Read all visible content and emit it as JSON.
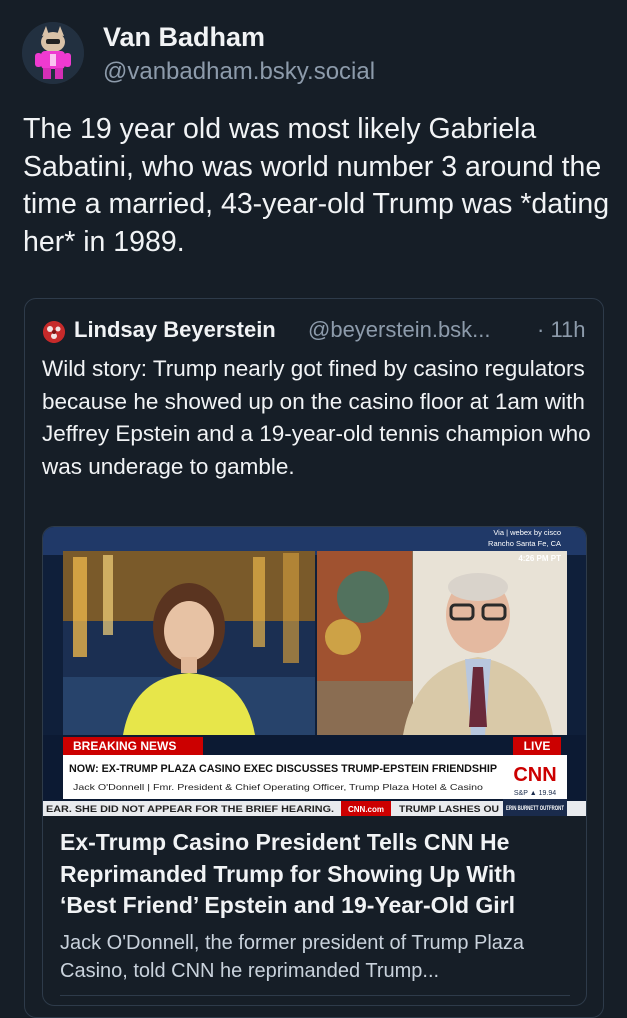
{
  "author": {
    "display_name": "Van Badham",
    "handle": "@vanbadham.bsky.social"
  },
  "post": {
    "text": "The 19 year old was most likely Gabriela Sabatini, who was world number 3 around the time a married, 43-year-old Trump was *dating her* in 1989."
  },
  "quote": {
    "display_name": "Lindsay Beyerstein",
    "handle": "@beyerstein.bsk...",
    "time": "· 11h",
    "text": "Wild story: Trump nearly got fined by casino regulators because he showed up on the casino floor at 1am with Jeffrey Epstein and a 19-year-old tennis champion who was underage to gamble."
  },
  "link_card": {
    "title": "Ex-Trump Casino President Tells CNN He Reprimanded Trump for Showing Up With ‘Best Friend’ Epstein and 19-Year-Old Girl",
    "description": "Jack O'Donnell, the former president of Trump Plaza Casino, told CNN he reprimanded Trump...",
    "thumbnail": {
      "via": "Via | webex by cisco",
      "location": "Rancho Santa Fe, CA",
      "clock": "4:26 PM PT",
      "breaking": "BREAKING NEWS",
      "live": "LIVE",
      "headline": "NOW: EX-TRUMP PLAZA CASINO EXEC DISCUSSES TRUMP-EPSTEIN FRIENDSHIP",
      "lower_third": "Jack O'Donnell  |  Fmr. President & Chief Operating Officer, Trump Plaza Hotel & Casino",
      "network": "CNN",
      "market": "S&P ▲ 19.94",
      "ticker": "EAR. SHE DID NOT APPEAR FOR THE BRIEF HEARING.",
      "ticker_brand": "CNN.com",
      "ticker2": "TRUMP LASHES OU",
      "show": "ERIN BURNETT OUTFRONT"
    }
  },
  "colors": {
    "background": "#161e27",
    "text_primary": "#f1f3f5",
    "text_secondary": "#8d9bab",
    "border": "#2e3b4a",
    "cnn_red": "#cc0000"
  }
}
